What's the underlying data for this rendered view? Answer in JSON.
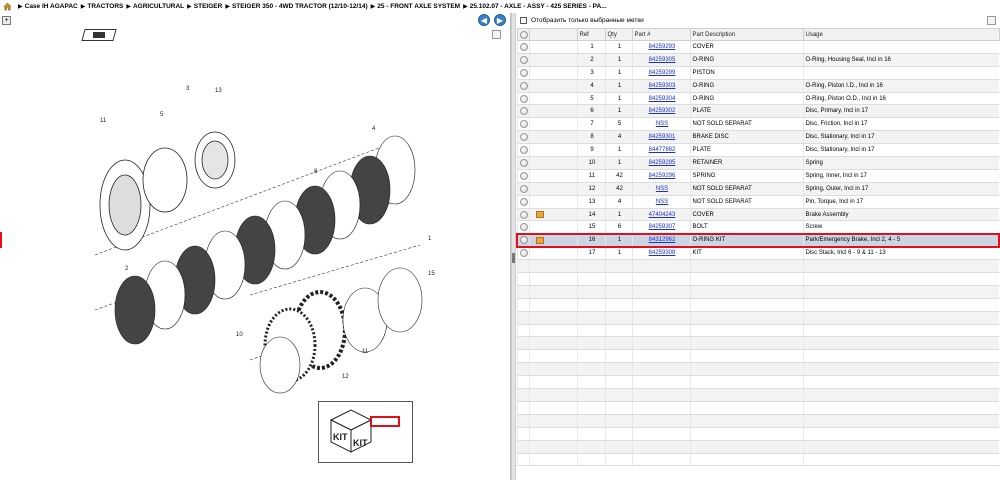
{
  "breadcrumb": [
    "Case IH AGAPAC",
    "TRACTORS",
    "AGRICULTURAL",
    "STEIGER",
    "STEIGER 350 - 4WD TRACTOR (12/10-12/14)",
    "25 - FRONT AXLE SYSTEM",
    "25.102.07 - AXLE - ASSY - 425 SERIES - PA..."
  ],
  "filter": {
    "label": "Отобразить только выбранные метки"
  },
  "table": {
    "headers": {
      "ref": "Ref",
      "qty": "Qty",
      "part": "Part #",
      "desc": "Part Description",
      "usage": "Usage"
    },
    "rows": [
      {
        "ref": "1",
        "qty": "1",
        "part": "84259293",
        "desc": "COVER",
        "usage": ""
      },
      {
        "ref": "2",
        "qty": "1",
        "part": "84259305",
        "desc": "O-RING",
        "usage": "O-Ring, Housing Seal, Incl in 16"
      },
      {
        "ref": "3",
        "qty": "1",
        "part": "84259299",
        "desc": "PISTON",
        "usage": ""
      },
      {
        "ref": "4",
        "qty": "1",
        "part": "84259303",
        "desc": "O-RING",
        "usage": "O-Ring, Piston I.D., Incl in 16"
      },
      {
        "ref": "5",
        "qty": "1",
        "part": "84259304",
        "desc": "O-RING",
        "usage": "O-Ring, Piston O.D., Incl in 16"
      },
      {
        "ref": "6",
        "qty": "1",
        "part": "84259302",
        "desc": "PLATE",
        "usage": "Disc, Primary, Incl in 17"
      },
      {
        "ref": "7",
        "qty": "5",
        "part": "NSS",
        "desc": "NOT SOLD SEPARAT",
        "usage": "Disc, Friction, Incl in 17"
      },
      {
        "ref": "8",
        "qty": "4",
        "part": "84259301",
        "desc": "BRAKE DISC",
        "usage": "Disc, Stationary, Incl in 17"
      },
      {
        "ref": "9",
        "qty": "1",
        "part": "84477882",
        "desc": "PLATE",
        "usage": "Disc, Stationary, Incl in 17"
      },
      {
        "ref": "10",
        "qty": "1",
        "part": "84259295",
        "desc": "RETAINER",
        "usage": "Spring"
      },
      {
        "ref": "11",
        "qty": "42",
        "part": "84259296",
        "desc": "SPRING",
        "usage": "Spring, Inner, Incl in 17"
      },
      {
        "ref": "12",
        "qty": "42",
        "part": "NSS",
        "desc": "NOT SOLD SEPARAT",
        "usage": "Spring, Outer, Incl in 17"
      },
      {
        "ref": "13",
        "qty": "4",
        "part": "NSS",
        "desc": "NOT SOLD SEPARAT",
        "usage": "Pin, Torque, Incl in 17"
      },
      {
        "ref": "14",
        "qty": "1",
        "part": "47404243",
        "desc": "COVER",
        "usage": "Brake Assembly"
      },
      {
        "ref": "15",
        "qty": "6",
        "part": "84259307",
        "desc": "BOLT",
        "usage": "Screw"
      },
      {
        "ref": "16",
        "qty": "1",
        "part": "84312962",
        "desc": "O-RING KIT",
        "usage": "Park/Emergency Brake, Incl 2, 4 - 5"
      },
      {
        "ref": "17",
        "qty": "1",
        "part": "84259308",
        "desc": "KIT",
        "usage": "Disc Stack, Incl 6 - 9 & 11 - 13"
      }
    ]
  },
  "diagram": {
    "callouts": [
      "1",
      "2",
      "3",
      "4",
      "5",
      "6",
      "7",
      "8",
      "9",
      "10",
      "11",
      "12",
      "13",
      "14",
      "15"
    ],
    "kit_label": "KIT"
  },
  "colors": {
    "selection_border": "#e0101a",
    "link": "#1a2fd6",
    "nav_button": "#3b7fc4"
  }
}
